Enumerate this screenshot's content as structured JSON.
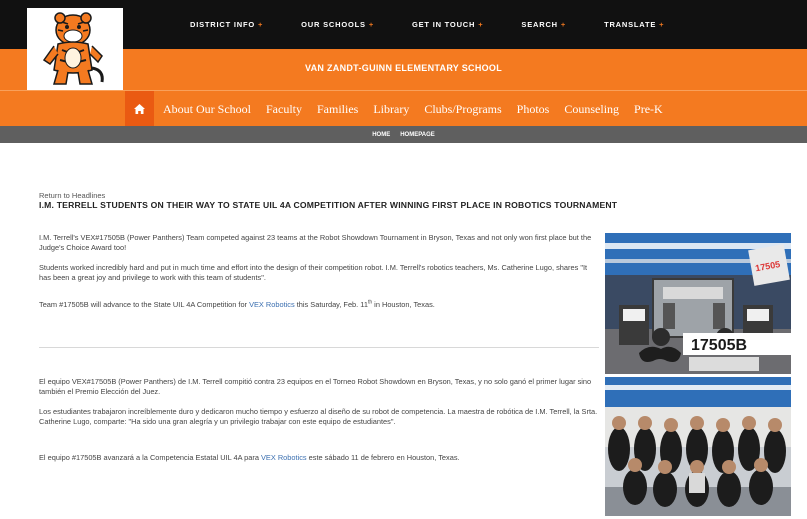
{
  "top_nav": [
    {
      "label": "DISTRICT INFO"
    },
    {
      "label": "OUR SCHOOLS"
    },
    {
      "label": "GET IN TOUCH"
    },
    {
      "label": "SEARCH"
    },
    {
      "label": "TRANSLATE"
    }
  ],
  "plus_glyph": "+",
  "school_name": "VAN ZANDT-GUINN ELEMENTARY SCHOOL",
  "main_nav": [
    {
      "label": "About Our School"
    },
    {
      "label": "Faculty"
    },
    {
      "label": "Families"
    },
    {
      "label": "Library"
    },
    {
      "label": "Clubs/Programs"
    },
    {
      "label": "Photos"
    },
    {
      "label": "Counseling"
    },
    {
      "label": "Pre-K"
    }
  ],
  "breadcrumb": {
    "home": "HOME",
    "current": "HOMEPAGE"
  },
  "article": {
    "return_link": "Return to Headlines",
    "headline": "I.M. TERRELL STUDENTS ON THEIR WAY TO STATE UIL 4A COMPETITION AFTER WINNING FIRST PLACE IN ROBOTICS TOURNAMENT",
    "p1": "I.M. Terrell's VEX#17505B (Power Panthers) Team competed against 23 teams at the Robot Showdown Tournament in Bryson, Texas and not only won first place but the Judge's Choice Award too!",
    "p2": "Students worked incredibly hard and put in much time and effort into the design of their competition robot. I.M. Terrell's robotics teachers, Ms. Catherine Lugo, shares \"It has been a great joy and privilege to work with this team of students\".",
    "p3_a": "Team #17505B will advance to the State UIL 4A Competition for ",
    "p3_link": "VEX Robotics",
    "p3_b": " this Saturday, Feb. 11",
    "p3_sup": "th",
    "p3_c": " in Houston, Texas.",
    "es1": "El equipo VEX#17505B (Power Panthers) de I.M. Terrell compitió contra 23 equipos en el Torneo Robot Showdown en Bryson, Texas, y no solo ganó el primer lugar sino también el Premio Elección del Juez.",
    "es2": "Los estudiantes trabajaron increíblemente duro y dedicaron mucho tiempo y esfuerzo al diseño de su robot de competencia. La maestra de robótica de I.M. Terrell, la Srta. Catherine Lugo, comparte: \"Ha sido una gran alegría y un privilegio trabajar con este equipo de estudiantes\".",
    "es3_a": "El equipo #17505B avanzará a la Competencia Estatal UIL 4A para ",
    "es3_link": "VEX Robotics",
    "es3_b": " este sábado 11 de febrero en Houston, Texas."
  },
  "photo_robot": {
    "sign_text": "17505B"
  },
  "colors": {
    "orange": "#f47a20",
    "dark": "#111111",
    "link": "#3b6fb0"
  }
}
